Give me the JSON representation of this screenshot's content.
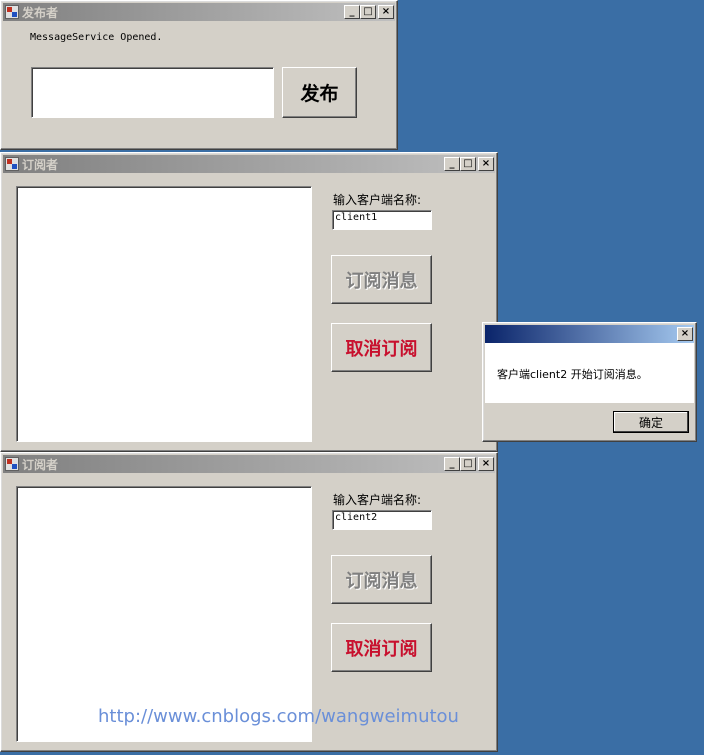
{
  "publisher": {
    "title": "发布者",
    "status_text": "MessageService Opened.",
    "message_input_value": "",
    "publish_button": "发布"
  },
  "subscribers": [
    {
      "title": "订阅者",
      "client_name_label": "输入客户端名称:",
      "client_name_value": "client1",
      "subscribe_button": "订阅消息",
      "unsubscribe_button": "取消订阅"
    },
    {
      "title": "订阅者",
      "client_name_label": "输入客户端名称:",
      "client_name_value": "client2",
      "subscribe_button": "订阅消息",
      "unsubscribe_button": "取消订阅"
    }
  ],
  "dialog": {
    "title": "",
    "message": "客户端client2 开始订阅消息。",
    "ok_button": "确定"
  },
  "window_controls": {
    "minimize": "_",
    "maximize": "□",
    "close": "×"
  },
  "watermark": "http://www.cnblogs.com/wangweimutou",
  "colors": {
    "desktop": "#3a6ea5",
    "unsubscribe_text": "#c8102e",
    "disabled_text": "#808080",
    "active_title_start": "#0a246a"
  }
}
